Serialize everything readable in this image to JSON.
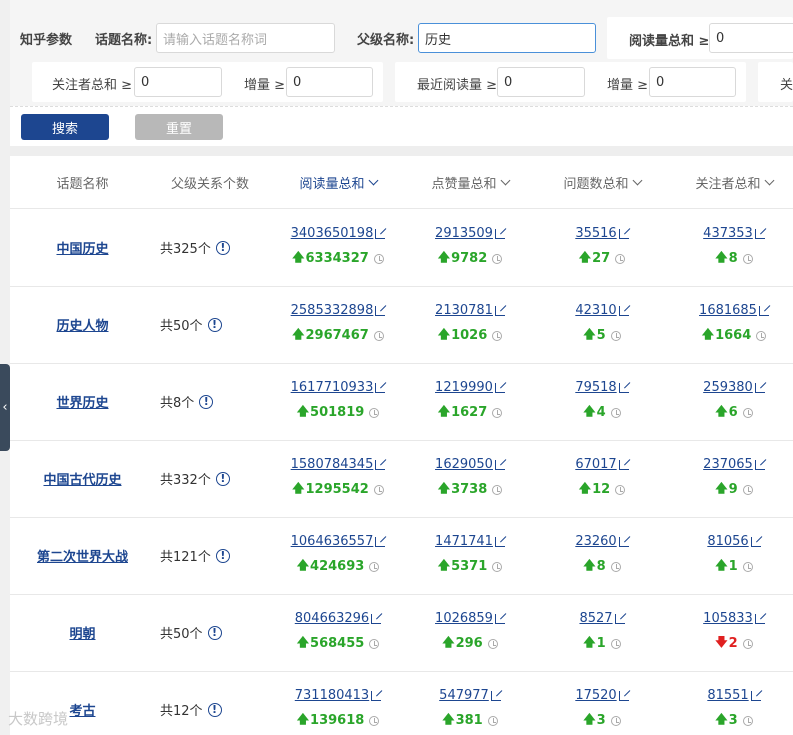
{
  "filters": {
    "section_title": "知乎参数",
    "topic_label": "话题名称:",
    "topic_placeholder": "请输入话题名称词",
    "parent_label": "父级名称:",
    "parent_value": "历史",
    "read_sum_label": "阅读量总和 ≥",
    "read_sum_value": "0",
    "follow_sum_label": "关注者总和 ≥",
    "follow_sum_value": "0",
    "incr1_label": "增量 ≥",
    "incr1_value": "0",
    "recent_read_label": "最近阅读量 ≥",
    "recent_read_value": "0",
    "incr2_label": "增量 ≥",
    "incr2_value": "0",
    "cut_label": "关"
  },
  "buttons": {
    "search": "搜索",
    "reset": "重置"
  },
  "table": {
    "headers": {
      "topic": "话题名称",
      "parent_count": "父级关系个数",
      "read_sum": "阅读量总和",
      "like_sum": "点赞量总和",
      "question_sum": "问题数总和",
      "follower_sum": "关注者总和"
    },
    "rows": [
      {
        "topic": "中国历史",
        "parent": "共325个",
        "read": "3403650198",
        "read_d": "6334327",
        "like": "2913509",
        "like_d": "9782",
        "q": "35516",
        "q_d": "27",
        "f": "437353",
        "f_d": "8",
        "f_dir": "up"
      },
      {
        "topic": "历史人物",
        "parent": "共50个",
        "read": "2585332898",
        "read_d": "2967467",
        "like": "2130781",
        "like_d": "1026",
        "q": "42310",
        "q_d": "5",
        "f": "1681685",
        "f_d": "1664",
        "f_dir": "up"
      },
      {
        "topic": "世界历史",
        "parent": "共8个",
        "read": "1617710933",
        "read_d": "501819",
        "like": "1219990",
        "like_d": "1627",
        "q": "79518",
        "q_d": "4",
        "f": "259380",
        "f_d": "6",
        "f_dir": "up"
      },
      {
        "topic": "中国古代历史",
        "parent": "共332个",
        "read": "1580784345",
        "read_d": "1295542",
        "like": "1629050",
        "like_d": "3738",
        "q": "67017",
        "q_d": "12",
        "f": "237065",
        "f_d": "9",
        "f_dir": "up"
      },
      {
        "topic": "第二次世界大战",
        "parent": "共121个",
        "read": "1064636557",
        "read_d": "424693",
        "like": "1471741",
        "like_d": "5371",
        "q": "23260",
        "q_d": "8",
        "f": "81056",
        "f_d": "1",
        "f_dir": "up"
      },
      {
        "topic": "明朝",
        "parent": "共50个",
        "read": "804663296",
        "read_d": "568455",
        "like": "1026859",
        "like_d": "296",
        "q": "8527",
        "q_d": "1",
        "f": "105833",
        "f_d": "2",
        "f_dir": "down"
      },
      {
        "topic": "考古",
        "parent": "共12个",
        "read": "731180413",
        "read_d": "139618",
        "like": "547977",
        "like_d": "381",
        "q": "17520",
        "q_d": "3",
        "f": "81551",
        "f_d": "3",
        "f_dir": "up"
      }
    ]
  },
  "side_tab": {
    "icon": "chevron-left-icon",
    "glyph": "‹"
  },
  "watermark": "大数跨境",
  "colors": {
    "primary": "#1d4690",
    "up": "#2aa52a",
    "down": "#e02020",
    "reset": "#b8b8b8"
  }
}
